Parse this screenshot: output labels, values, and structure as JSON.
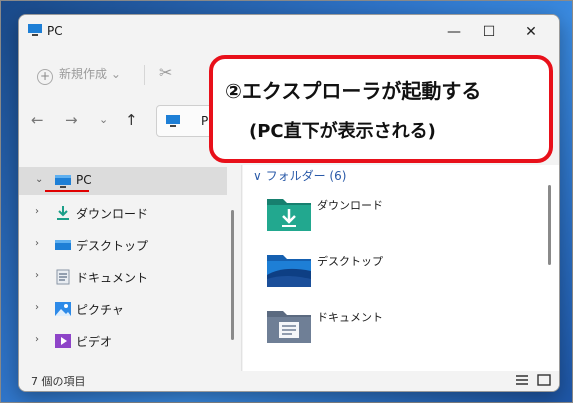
{
  "window": {
    "title": "PC"
  },
  "title_buttons": {
    "minimize": "—",
    "maximize": "☐",
    "close": "✕"
  },
  "toolbar": {
    "new_label": "新規作成",
    "new_chevron": "⌄",
    "plus": "+",
    "cut": "✂"
  },
  "nav": {
    "back": "←",
    "forward": "→",
    "recent": "⌄",
    "up": "↑",
    "address": "PC"
  },
  "sidebar": {
    "items": [
      {
        "label": "PC",
        "chevron": "⌄",
        "icon": "pc-icon"
      },
      {
        "label": "ダウンロード",
        "chevron": "›",
        "icon": "download-icon"
      },
      {
        "label": "デスクトップ",
        "chevron": "›",
        "icon": "desktop-icon"
      },
      {
        "label": "ドキュメント",
        "chevron": "›",
        "icon": "document-icon"
      },
      {
        "label": "ピクチャ",
        "chevron": "›",
        "icon": "pictures-icon"
      },
      {
        "label": "ビデオ",
        "chevron": "›",
        "icon": "video-icon"
      }
    ]
  },
  "content": {
    "group_heading": "∨ フォルダー (6)",
    "folders": [
      {
        "label": "ダウンロード",
        "icon": "download-folder-icon"
      },
      {
        "label": "デスクトップ",
        "icon": "desktop-folder-icon"
      },
      {
        "label": "ドキュメント",
        "icon": "documents-folder-icon"
      }
    ]
  },
  "status": {
    "item_count": "7 個の項目"
  },
  "callout": {
    "line1": "②エクスプローラが起動する",
    "line2": "(PC直下が表示される)"
  },
  "colors": {
    "accent": "#2a5aa8",
    "callout_border": "#e8101a",
    "teal": "#1b9e88"
  }
}
